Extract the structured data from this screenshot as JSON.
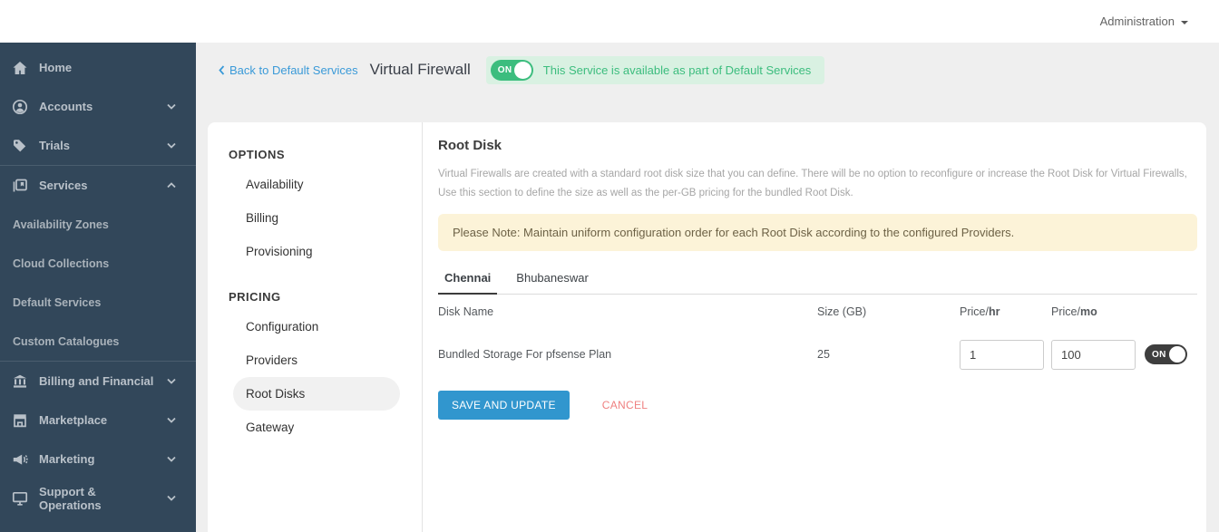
{
  "topbar": {
    "menu_label": "Administration"
  },
  "sidebar": {
    "top_items": [
      {
        "label": "Home"
      },
      {
        "label": "Accounts"
      },
      {
        "label": "Trials"
      }
    ],
    "services": {
      "label": "Services"
    },
    "services_subitems": [
      {
        "label": "Availability Zones"
      },
      {
        "label": "Cloud Collections"
      },
      {
        "label": "Default Services"
      },
      {
        "label": "Custom Catalogues"
      }
    ],
    "bottom_items": [
      {
        "label": "Billing and Financial"
      },
      {
        "label": "Marketplace"
      },
      {
        "label": "Marketing"
      },
      {
        "label": "Support & Operations"
      }
    ]
  },
  "header": {
    "back_label": "Back to Default Services",
    "title": "Virtual Firewall",
    "toggle_label": "ON",
    "status_text": "This Service is available as part of Default Services"
  },
  "menu": {
    "options_title": "OPTIONS",
    "options_items": [
      {
        "label": "Availability"
      },
      {
        "label": "Billing"
      },
      {
        "label": "Provisioning"
      }
    ],
    "pricing_title": "PRICING",
    "pricing_items": [
      {
        "label": "Configuration"
      },
      {
        "label": "Providers"
      },
      {
        "label": "Root Disks"
      },
      {
        "label": "Gateway"
      }
    ]
  },
  "content": {
    "title": "Root Disk",
    "description": "Virtual Firewalls are created with a standard root disk size that you can define. There will be no option to reconfigure or increase the Root Disk for Virtual Firewalls, Use this section to define the size as well as the per-GB pricing for the bundled Root Disk.",
    "note": "Please Note: Maintain uniform configuration order for each Root Disk according to the configured Providers.",
    "tabs": [
      {
        "label": "Chennai"
      },
      {
        "label": "Bhubaneswar"
      }
    ],
    "table": {
      "columns": {
        "disk_name": "Disk Name",
        "size": "Size (GB)",
        "price_hr_prefix": "Price/",
        "price_hr_suffix": "hr",
        "price_mo_prefix": "Price/",
        "price_mo_suffix": "mo"
      },
      "rows": [
        {
          "disk_name": "Bundled Storage For pfsense Plan",
          "size_gb": "25",
          "price_hr": "1",
          "price_mo": "100",
          "toggle_label": "ON"
        }
      ]
    },
    "actions": {
      "save_label": "SAVE AND UPDATE",
      "cancel_label": "CANCEL"
    }
  },
  "colors": {
    "sidebar_bg": "#32475a",
    "accent_blue": "#3a9ad8",
    "green": "#3cbd7e",
    "green_badge_bg": "#d9f1e2",
    "note_bg": "#fcf3d8",
    "note_text": "#6d6246",
    "save_button_bg": "#3196ce",
    "cancel_text": "#ef8080",
    "dark_toggle_bg": "#3e3e3e",
    "menu_active_bg": "#f1f1f1"
  }
}
